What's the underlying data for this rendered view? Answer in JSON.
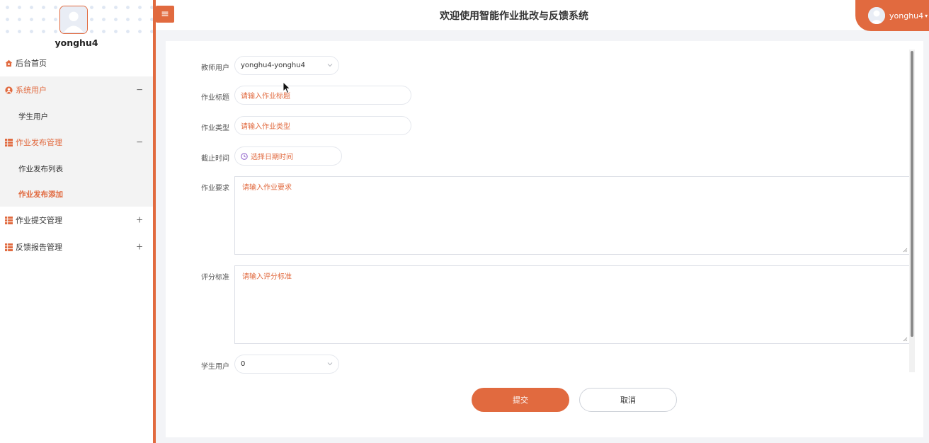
{
  "sidebar": {
    "username": "yonghu4",
    "menu": [
      {
        "label": "后台首页",
        "icon": "home-icon"
      },
      {
        "label": "系统用户",
        "icon": "user-circle-icon",
        "toggle": "−",
        "children": [
          {
            "label": "学生用户"
          }
        ]
      },
      {
        "label": "作业发布管理",
        "icon": "grid-icon",
        "toggle": "−",
        "children": [
          {
            "label": "作业发布列表"
          },
          {
            "label": "作业发布添加"
          }
        ]
      },
      {
        "label": "作业提交管理",
        "icon": "grid-icon",
        "toggle": "+"
      },
      {
        "label": "反馈报告管理",
        "icon": "grid-icon",
        "toggle": "+"
      }
    ]
  },
  "header": {
    "menu_icon": "≡",
    "title": "欢迎使用智能作业批改与反馈系统",
    "user": "yonghu4",
    "user_caret": "▾"
  },
  "form": {
    "teacher": {
      "label": "教师用户",
      "value": "yonghu4-yonghu4"
    },
    "title": {
      "label": "作业标题",
      "placeholder": "请输入作业标题"
    },
    "type": {
      "label": "作业类型",
      "placeholder": "请输入作业类型"
    },
    "deadline": {
      "label": "截止时间",
      "placeholder": "选择日期时间"
    },
    "requirements": {
      "label": "作业要求",
      "placeholder": "请输入作业要求"
    },
    "criteria": {
      "label": "评分标准",
      "placeholder": "请输入评分标准"
    },
    "student": {
      "label": "学生用户",
      "value": "0"
    }
  },
  "buttons": {
    "submit": "提交",
    "cancel": "取消"
  },
  "colors": {
    "accent": "#e16a3f"
  }
}
